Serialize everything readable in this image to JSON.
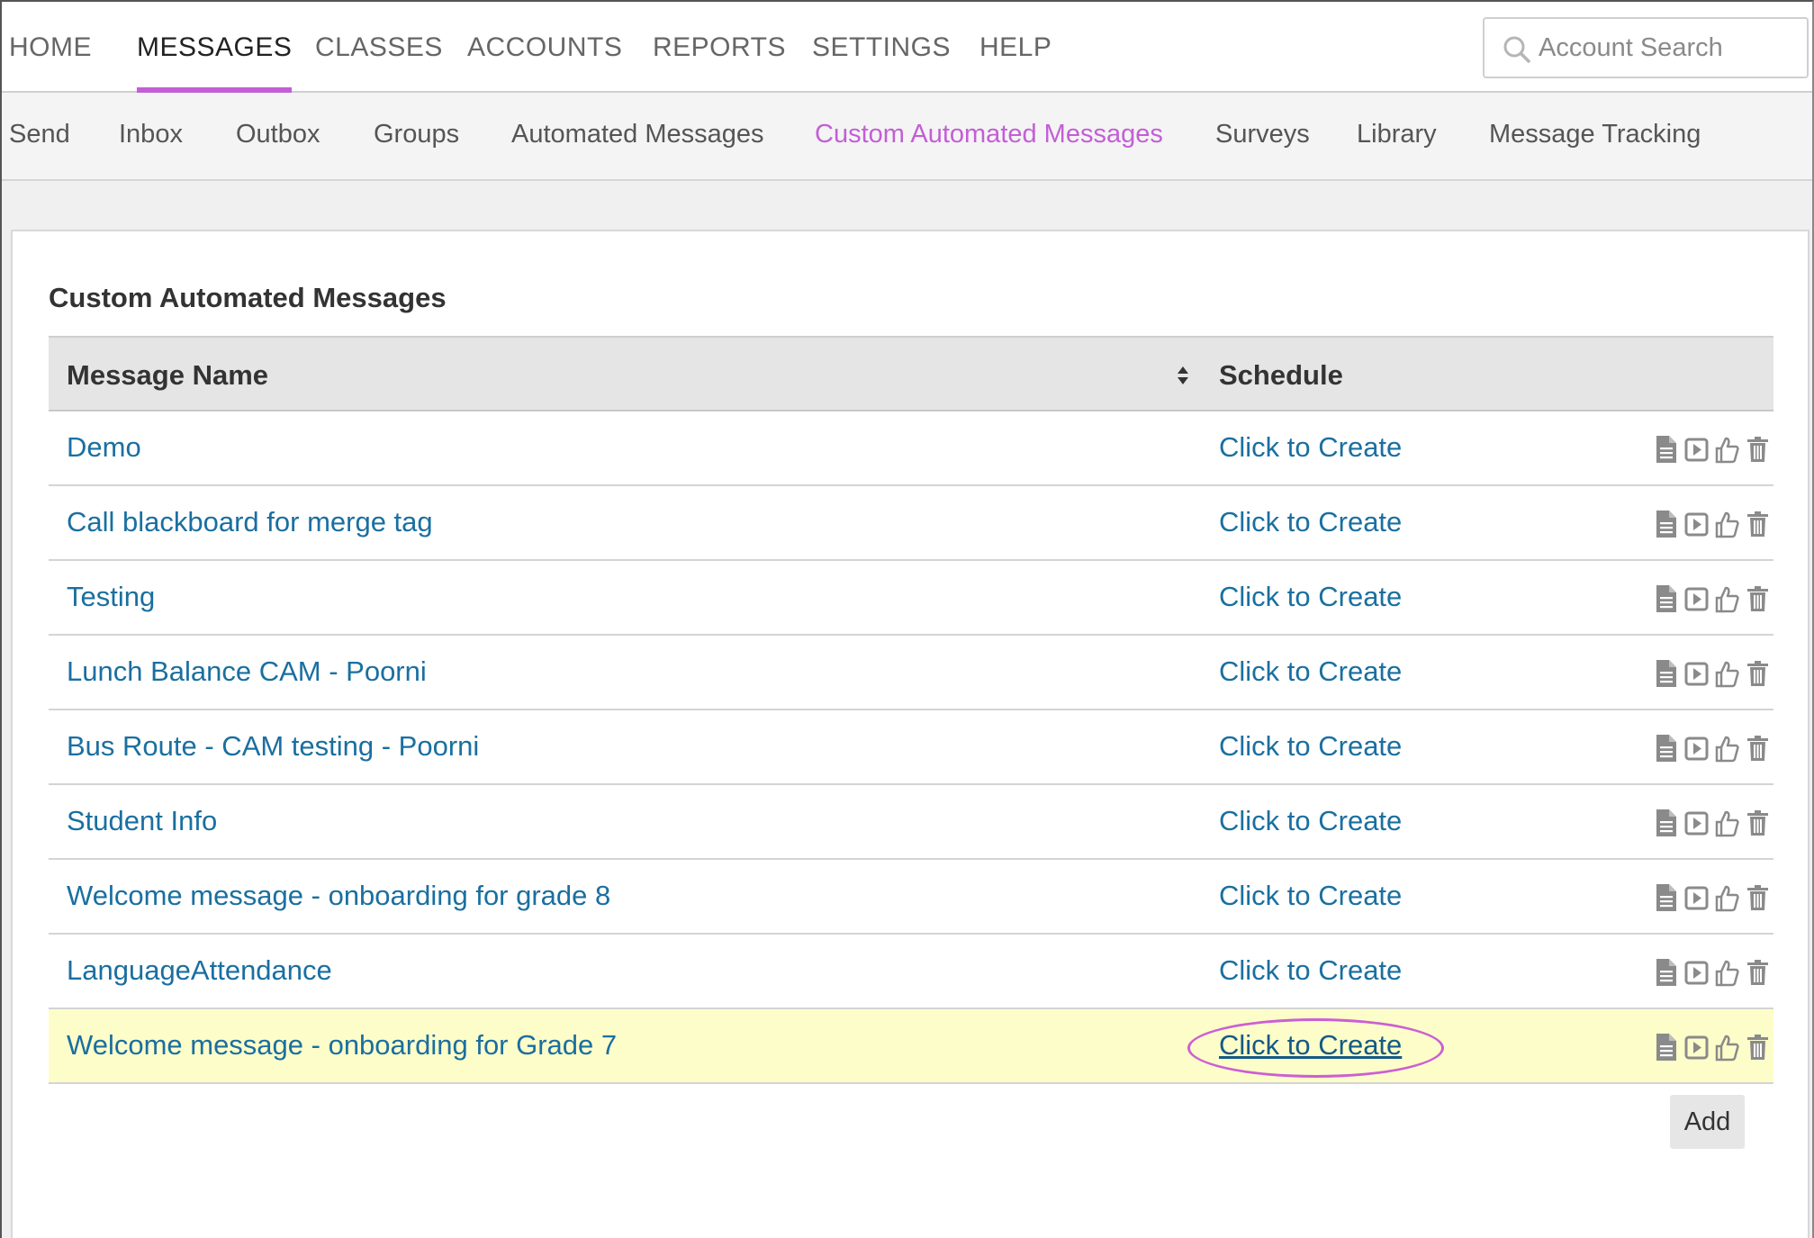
{
  "topnav": {
    "items": [
      {
        "label": "HOME",
        "active": false
      },
      {
        "label": "MESSAGES",
        "active": true
      },
      {
        "label": "CLASSES",
        "active": false
      },
      {
        "label": "ACCOUNTS",
        "active": false
      },
      {
        "label": "REPORTS",
        "active": false
      },
      {
        "label": "SETTINGS",
        "active": false
      },
      {
        "label": "HELP",
        "active": false
      }
    ],
    "search_placeholder": "Account Search"
  },
  "subnav": {
    "items": [
      {
        "label": "Send",
        "active": false
      },
      {
        "label": "Inbox",
        "active": false
      },
      {
        "label": "Outbox",
        "active": false
      },
      {
        "label": "Groups",
        "active": false
      },
      {
        "label": "Automated Messages",
        "active": false
      },
      {
        "label": "Custom Automated Messages",
        "active": true
      },
      {
        "label": "Surveys",
        "active": false
      },
      {
        "label": "Library",
        "active": false
      },
      {
        "label": "Message Tracking",
        "active": false
      }
    ]
  },
  "main": {
    "title": "Custom Automated Messages",
    "columns": {
      "name": "Message Name",
      "schedule": "Schedule"
    },
    "rows": [
      {
        "name": "Demo",
        "schedule": "Click to Create"
      },
      {
        "name": "Call blackboard for merge tag",
        "schedule": "Click to Create"
      },
      {
        "name": "Testing",
        "schedule": "Click to Create"
      },
      {
        "name": "Lunch Balance CAM - Poorni",
        "schedule": "Click to Create"
      },
      {
        "name": "Bus Route - CAM testing - Poorni",
        "schedule": "Click to Create"
      },
      {
        "name": "Student Info",
        "schedule": "Click to Create"
      },
      {
        "name": "Welcome message - onboarding for grade 8",
        "schedule": "Click to Create"
      },
      {
        "name": "LanguageAttendance",
        "schedule": "Click to Create"
      },
      {
        "name": "Welcome message - onboarding for Grade 7",
        "schedule": "Click to Create",
        "highlighted": true
      }
    ],
    "row_actions": [
      "document-icon",
      "play-icon",
      "thumbs-up-icon",
      "trash-icon"
    ],
    "add_label": "Add"
  },
  "colors": {
    "accent": "#c35ed6",
    "link": "#1a6fa0",
    "highlight_row": "#fdfdc9"
  }
}
